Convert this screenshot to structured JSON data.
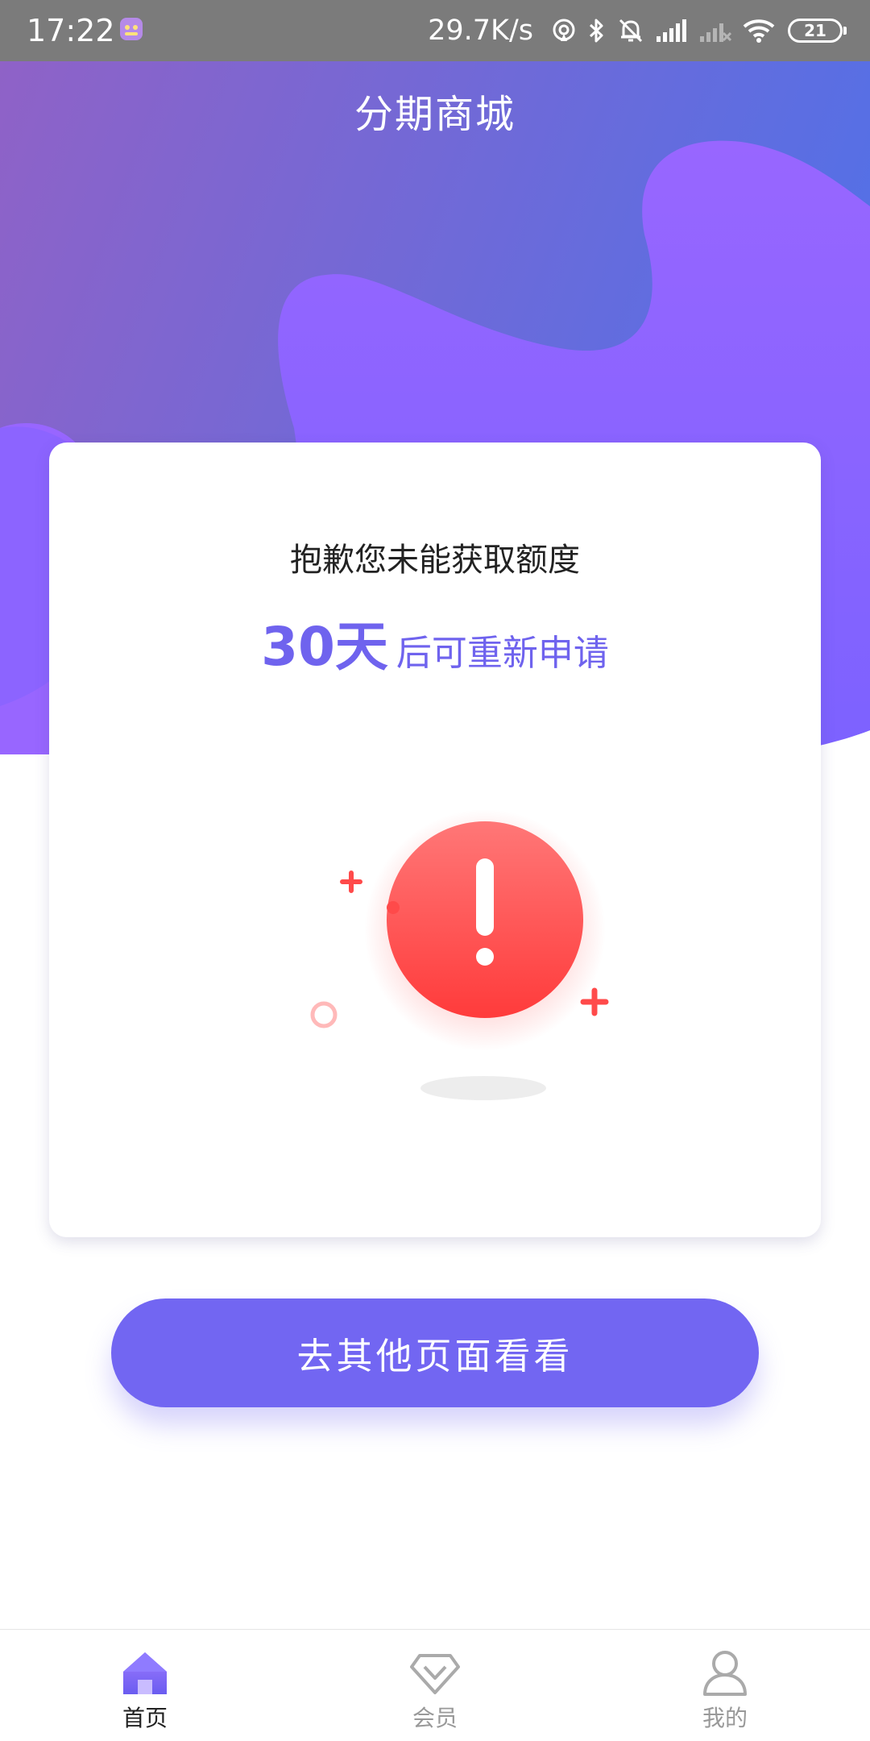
{
  "status_bar": {
    "time": "17:22",
    "network_speed": "29.7K/s",
    "battery_level": "21",
    "icons": [
      "app-notification-icon",
      "hotspot-icon",
      "bluetooth-icon",
      "mute-icon",
      "signal-icon",
      "signal-no-service-icon",
      "wifi-icon",
      "battery-icon"
    ]
  },
  "header": {
    "title": "分期商城"
  },
  "card": {
    "message": "抱歉您未能获取额度",
    "days": "30天",
    "reapply_text": "后可重新申请",
    "illustration_icon": "exclamation-alert-icon"
  },
  "primary_button": {
    "label": "去其他页面看看"
  },
  "tabs": [
    {
      "label": "首页",
      "icon": "home-icon",
      "active": true
    },
    {
      "label": "会员",
      "icon": "diamond-icon",
      "active": false
    },
    {
      "label": "我的",
      "icon": "user-icon",
      "active": false
    }
  ],
  "colors": {
    "accent": "#7266f2",
    "alert_red": "#ff4a4a",
    "header_gradient_start": "#8f62c7",
    "header_gradient_end": "#5470e6"
  }
}
